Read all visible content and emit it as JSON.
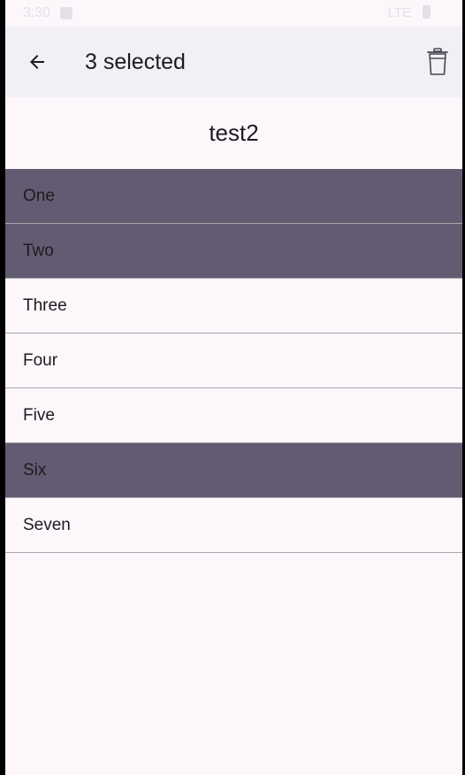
{
  "status_bar": {
    "time": "3:30",
    "network": "LTE"
  },
  "app_bar": {
    "back_icon": "arrow-left-icon",
    "title": "3 selected",
    "delete_icon": "trash-icon"
  },
  "list": {
    "title": "test2",
    "items": [
      {
        "label": "One",
        "selected": true
      },
      {
        "label": "Two",
        "selected": true
      },
      {
        "label": "Three",
        "selected": false
      },
      {
        "label": "Four",
        "selected": false
      },
      {
        "label": "Five",
        "selected": false
      },
      {
        "label": "Six",
        "selected": true
      },
      {
        "label": "Seven",
        "selected": false
      }
    ]
  },
  "colors": {
    "background": "#fdf7fb",
    "app_bar": "#f2eff5",
    "selected_row": "#625b71",
    "divider": "#a8a6ab"
  }
}
